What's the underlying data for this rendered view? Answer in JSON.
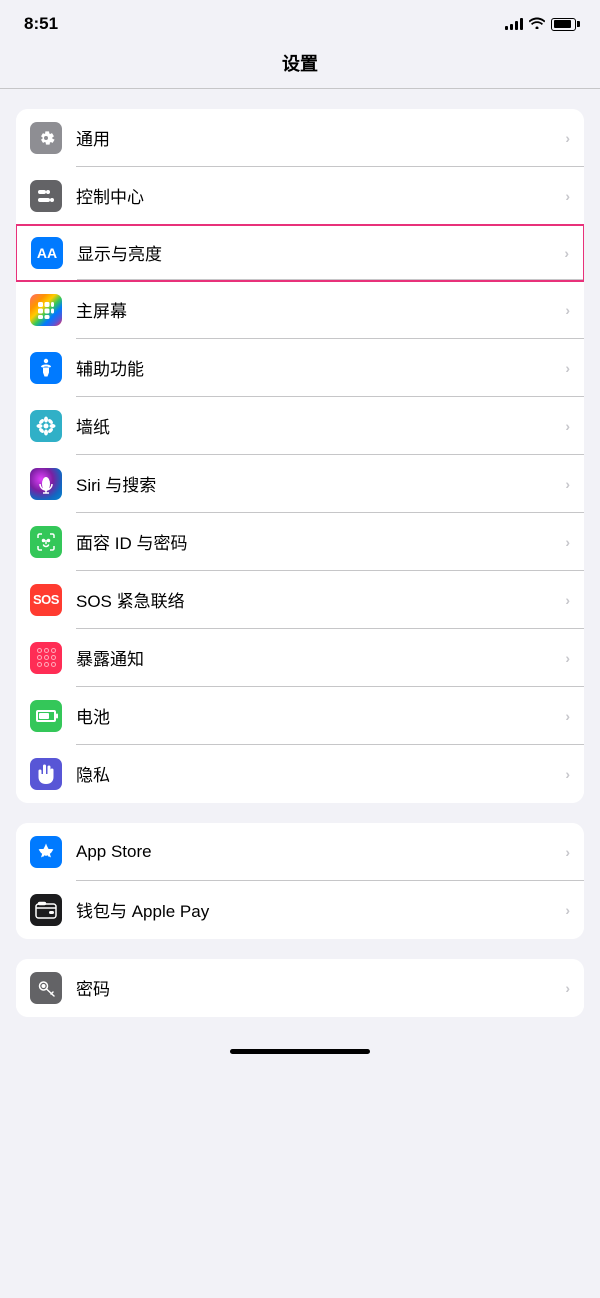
{
  "statusBar": {
    "time": "8:51",
    "signal": "full",
    "wifi": true,
    "battery": "full"
  },
  "pageTitle": "设置",
  "groups": [
    {
      "id": "group1",
      "highlighted": false,
      "items": [
        {
          "id": "general",
          "label": "通用",
          "iconType": "gear",
          "iconBg": "gray"
        },
        {
          "id": "control-center",
          "label": "控制中心",
          "iconType": "toggles",
          "iconBg": "gray2"
        },
        {
          "id": "display",
          "label": "显示与亮度",
          "iconType": "aa",
          "iconBg": "blue",
          "highlighted": true
        },
        {
          "id": "home-screen",
          "label": "主屏幕",
          "iconType": "grid",
          "iconBg": "purple-multi"
        },
        {
          "id": "accessibility",
          "label": "辅助功能",
          "iconType": "accessibility",
          "iconBg": "blue-access"
        },
        {
          "id": "wallpaper",
          "label": "墙纸",
          "iconType": "flower",
          "iconBg": "teal"
        },
        {
          "id": "siri",
          "label": "Siri 与搜索",
          "iconType": "siri",
          "iconBg": "gradient-siri"
        },
        {
          "id": "face-id",
          "label": "面容 ID 与密码",
          "iconType": "face-id",
          "iconBg": "green-face"
        },
        {
          "id": "sos",
          "label": "SOS 紧急联络",
          "iconType": "sos",
          "iconBg": "red-sos"
        },
        {
          "id": "exposure",
          "label": "暴露通知",
          "iconType": "exposure",
          "iconBg": "pink-exposure"
        },
        {
          "id": "battery",
          "label": "电池",
          "iconType": "battery",
          "iconBg": "green-battery"
        },
        {
          "id": "privacy",
          "label": "隐私",
          "iconType": "hand",
          "iconBg": "indigo-privacy"
        }
      ]
    },
    {
      "id": "group2",
      "highlighted": false,
      "items": [
        {
          "id": "app-store",
          "label": "App Store",
          "iconType": "appstore",
          "iconBg": "blue-appstore"
        },
        {
          "id": "wallet",
          "label": "钱包与 Apple Pay",
          "iconType": "wallet",
          "iconBg": "green-wallet"
        }
      ]
    },
    {
      "id": "group3",
      "highlighted": false,
      "items": [
        {
          "id": "passwords",
          "label": "密码",
          "iconType": "key",
          "iconBg": "gray-pwd"
        }
      ]
    }
  ],
  "chevron": "›"
}
